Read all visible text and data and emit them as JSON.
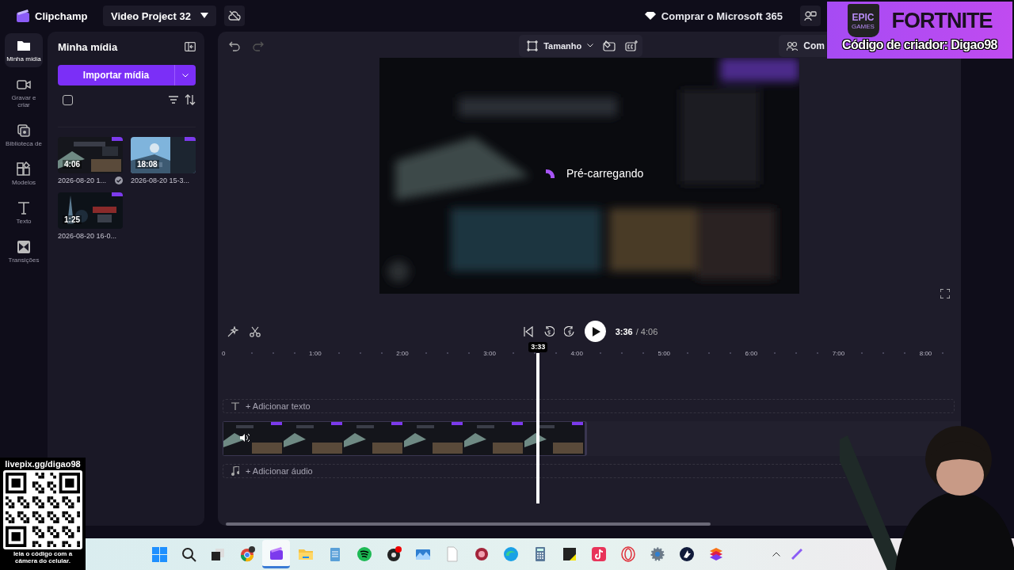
{
  "app": {
    "name": "Clipchamp",
    "project": "Video Project 32",
    "upgrade": "Comprar o Microsoft 365"
  },
  "nav": [
    {
      "label": "Minha mídia",
      "selected": true
    },
    {
      "label": "Gravar e criar",
      "selected": false
    },
    {
      "label": "Biblioteca de",
      "selected": false
    },
    {
      "label": "Modelos",
      "selected": false
    },
    {
      "label": "Texto",
      "selected": false
    },
    {
      "label": "Transições",
      "selected": false
    }
  ],
  "media": {
    "title": "Minha mídia",
    "import": "Importar mídia",
    "select_all_checked": false,
    "items": [
      {
        "duration": "4:06",
        "name": "2026-08-20 1...",
        "in_use": true
      },
      {
        "duration": "18:08",
        "name": "2026-08-20 15-3...",
        "in_use": false
      },
      {
        "duration": "1:25",
        "name": "2026-08-20 16-0...",
        "in_use": false
      }
    ]
  },
  "editor": {
    "size_label": "Tamanho",
    "share_label": "Com",
    "status": "Pré-carregando",
    "time_current": "3:36",
    "time_total": "/ 4:06",
    "ruler": [
      "0",
      "1:00",
      "2:00",
      "3:00",
      "4:00",
      "5:00",
      "6:00",
      "7:00",
      "8:00"
    ],
    "playhead": {
      "label": "3:33",
      "level": 0.444
    },
    "text_track": "+ Adicionar texto",
    "audio_track": "+ Adicionar áudio"
  },
  "overlays": {
    "promo": {
      "brand": "EPIC",
      "brand_sub": "GAMES",
      "game": "FORTNITE",
      "code": "Código de criador: Digao98"
    },
    "qr": {
      "url": "livepix.gg/digao98",
      "caption": "leia o código com a câmera do celular."
    }
  },
  "taskbar": [
    {
      "kind": "windows",
      "active": false
    },
    {
      "kind": "search",
      "active": false
    },
    {
      "kind": "taskview",
      "active": false
    },
    {
      "kind": "chrome",
      "active": false
    },
    {
      "kind": "clipchamp",
      "active": true
    },
    {
      "kind": "files",
      "active": false
    },
    {
      "kind": "notepad",
      "active": false
    },
    {
      "kind": "spotify",
      "active": false
    },
    {
      "kind": "obs",
      "active": false
    },
    {
      "kind": "photos",
      "active": false
    },
    {
      "kind": "document",
      "active": false
    },
    {
      "kind": "redapp",
      "active": false
    },
    {
      "kind": "edge",
      "active": false
    },
    {
      "kind": "calculator",
      "active": false
    },
    {
      "kind": "sticky",
      "active": false
    },
    {
      "kind": "tiktok",
      "active": false
    },
    {
      "kind": "opera",
      "active": false
    },
    {
      "kind": "settings",
      "active": false
    },
    {
      "kind": "darkapp",
      "active": false
    },
    {
      "kind": "stackapp",
      "active": false
    }
  ]
}
